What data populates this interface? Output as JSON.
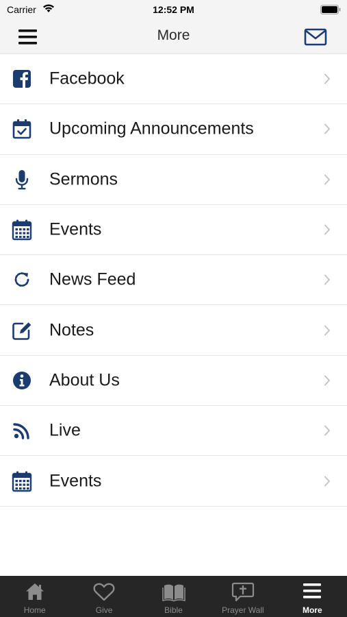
{
  "status_bar": {
    "carrier": "Carrier",
    "time": "12:52 PM"
  },
  "nav_bar": {
    "title": "More"
  },
  "colors": {
    "accent": "#1c3b6e",
    "tab_bar": "#262626",
    "tab_inactive": "#8c8c8c"
  },
  "menu": {
    "items": [
      {
        "label": "Facebook",
        "icon": "facebook-icon"
      },
      {
        "label": "Upcoming Announcements",
        "icon": "calendar-check-icon"
      },
      {
        "label": "Sermons",
        "icon": "microphone-icon"
      },
      {
        "label": "Events",
        "icon": "calendar-icon"
      },
      {
        "label": "News Feed",
        "icon": "refresh-icon"
      },
      {
        "label": "Notes",
        "icon": "edit-icon"
      },
      {
        "label": "About Us",
        "icon": "info-icon"
      },
      {
        "label": "Live",
        "icon": "rss-icon"
      },
      {
        "label": "Events",
        "icon": "calendar-icon"
      }
    ]
  },
  "tab_bar": {
    "tabs": [
      {
        "label": "Home",
        "icon": "home-icon"
      },
      {
        "label": "Give",
        "icon": "heart-icon"
      },
      {
        "label": "Bible",
        "icon": "book-icon"
      },
      {
        "label": "Prayer Wall",
        "icon": "prayer-icon"
      },
      {
        "label": "More",
        "icon": "menu-icon",
        "active": true
      }
    ]
  }
}
